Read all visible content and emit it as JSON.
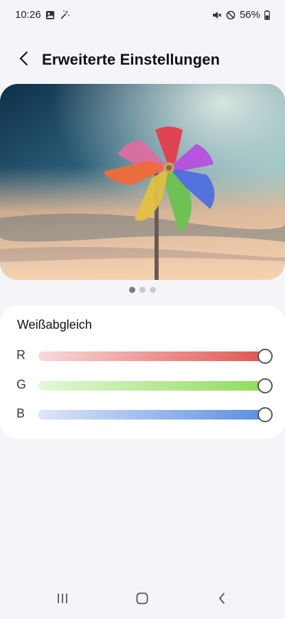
{
  "status_bar": {
    "time": "10:26",
    "battery": "56%",
    "left_icons": [
      "image-icon",
      "magic-wand-icon"
    ],
    "right_icons": [
      "mute-icon",
      "do-not-disturb-icon",
      "battery-icon"
    ]
  },
  "header": {
    "title": "Erweiterte Einstellungen"
  },
  "preview": {
    "page_count": 3,
    "active_page": 1
  },
  "white_balance": {
    "title": "Weißabgleich",
    "sliders": [
      {
        "label": "R",
        "value": 1.0,
        "color_light": "#f6dada",
        "color_dark": "#e0564f"
      },
      {
        "label": "G",
        "value": 1.0,
        "color_light": "#e4f8d8",
        "color_dark": "#8fdb5c"
      },
      {
        "label": "B",
        "value": 1.0,
        "color_light": "#dde6f8",
        "color_dark": "#5b8ee0"
      }
    ]
  },
  "nav_bar": {
    "icons": [
      "recent-apps-icon",
      "home-icon",
      "back-icon"
    ]
  }
}
